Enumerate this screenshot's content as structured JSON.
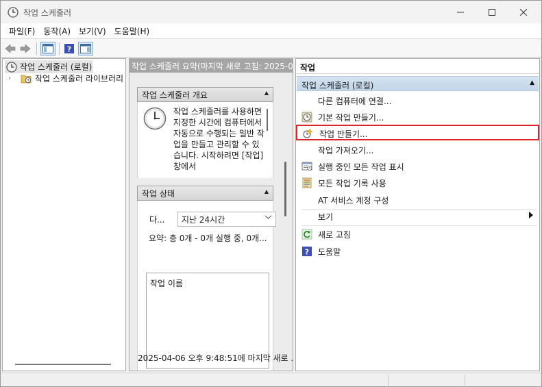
{
  "window": {
    "title": "작업 스케줄러",
    "controls": {
      "minimize": "—",
      "maximize": "☐",
      "close": "✕"
    }
  },
  "menubar": {
    "items": [
      {
        "label": "파일(F)"
      },
      {
        "label": "동작(A)"
      },
      {
        "label": "보기(V)"
      },
      {
        "label": "도움말(H)"
      }
    ]
  },
  "tree": {
    "root": "작업 스케줄러 (로컬)",
    "child": "작업 스케줄러 라이브러리"
  },
  "middle": {
    "header": "작업 스케줄러 요약(마지막 새로 고침: 2025-0",
    "overview": {
      "title": "작업 스케줄러 개요",
      "text": "작업 스케줄러를 사용하면 지정한 시간에 컴퓨터에서 자동으로 수행되는 일반 작업을 만들고 관리할 수 있습니다. 시작하려면 [작업] 창에서"
    },
    "status": {
      "title": "작업 상태",
      "filter_label": "다...",
      "filter_value": "지난 24시간",
      "summary": "요약: 총 0개 - 0개 실행 중, 0개...",
      "list_header": "작업 이름"
    },
    "footer": "2025-04-06 오후 9:48:51에 마지막 새로 ..."
  },
  "actions": {
    "header": "작업",
    "group": "작업 스케줄러 (로컬)",
    "items": [
      {
        "label": "다른 컴퓨터에 연결...",
        "icon": "none"
      },
      {
        "label": "기본 작업 만들기...",
        "icon": "clock-icon"
      },
      {
        "label": "작업 만들기...",
        "icon": "create-task-icon"
      },
      {
        "label": "작업 가져오기...",
        "icon": "none"
      },
      {
        "label": "실행 중인 모든 작업 표시",
        "icon": "running-tasks-icon"
      },
      {
        "label": "모든 작업 기록 사용",
        "icon": "history-icon"
      },
      {
        "label": "AT 서비스 계정 구성",
        "icon": "none"
      },
      {
        "label": "보기",
        "icon": "none"
      },
      {
        "label": "새로 고침",
        "icon": "refresh-icon"
      },
      {
        "label": "도움말",
        "icon": "help-icon"
      }
    ]
  },
  "colors": {
    "highlight_border": "#d9252b",
    "group_band": "#c9d9eb",
    "mid_header": "#a5a5a5"
  }
}
